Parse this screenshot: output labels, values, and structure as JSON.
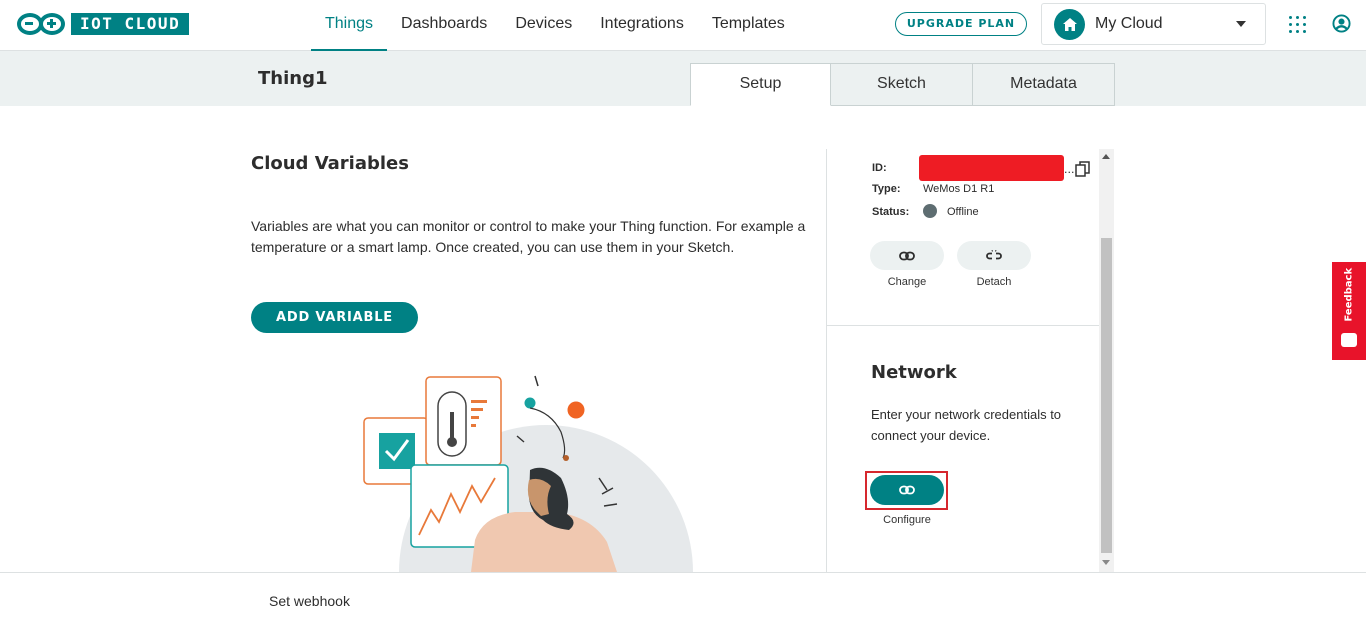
{
  "brand": {
    "logo_text": "IOT CLOUD"
  },
  "nav": {
    "items": [
      {
        "label": "Things",
        "active": true
      },
      {
        "label": "Dashboards"
      },
      {
        "label": "Devices"
      },
      {
        "label": "Integrations"
      },
      {
        "label": "Templates"
      }
    ],
    "upgrade_label": "UPGRADE PLAN",
    "space_name": "My Cloud"
  },
  "thing": {
    "title": "Thing1",
    "tabs": [
      {
        "label": "Setup",
        "active": true
      },
      {
        "label": "Sketch"
      },
      {
        "label": "Metadata"
      }
    ]
  },
  "cloud_variables": {
    "title": "Cloud Variables",
    "description": "Variables are what you can monitor or control to make your Thing function. For example a temperature or a smart lamp. Once created, you can use them in your Sketch.",
    "add_button": "ADD VARIABLE"
  },
  "device": {
    "id_label": "ID:",
    "id_ellipsis": "...",
    "type_label": "Type:",
    "type_value": "WeMos D1 R1",
    "status_label": "Status:",
    "status_value": "Offline",
    "change_label": "Change",
    "detach_label": "Detach"
  },
  "network": {
    "title": "Network",
    "description": "Enter your network credentials to connect your device.",
    "configure_label": "Configure"
  },
  "feedback": {
    "label": "Feedback"
  },
  "footer": {
    "webhook_label": "Set webhook"
  },
  "colors": {
    "accent": "#008184",
    "highlight": "#d6282e",
    "feedback": "#e8132a",
    "redaction": "#ee1c24"
  }
}
